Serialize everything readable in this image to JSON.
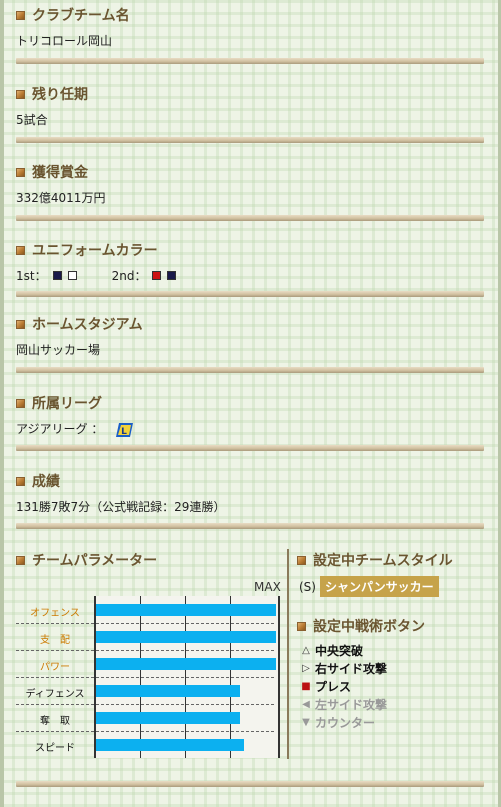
{
  "sections": {
    "club": {
      "title": "クラブチーム名",
      "value": "トリコロール岡山"
    },
    "term": {
      "title": "残り任期",
      "value": "5試合"
    },
    "prize": {
      "title": "獲得賞金",
      "value": "332億4011万円"
    },
    "uniform": {
      "title": "ユニフォームカラー",
      "first_label": "1st：",
      "second_label": "2nd：",
      "first_colors": [
        "#1a1a4a",
        "#ffffff"
      ],
      "second_colors": [
        "#cc1111",
        "#1a1a4a"
      ]
    },
    "stadium": {
      "title": "ホームスタジアム",
      "value": "岡山サッカー場"
    },
    "league": {
      "title": "所属リーグ",
      "value": "アジアリーグ ：",
      "logo_icon": "league-logo-icon"
    },
    "record": {
      "title": "成績",
      "value": "131勝7敗7分（公式戦記録：29連勝）"
    }
  },
  "parameters": {
    "title": "チームパラメーター",
    "max_label": "MAX",
    "rows": [
      {
        "label": "オフェンス",
        "value": 1.0,
        "color": "#cc7a00"
      },
      {
        "label": "支　配",
        "value": 1.0,
        "color": "#cc7a00"
      },
      {
        "label": "パワー",
        "value": 1.0,
        "color": "#cc7a00"
      },
      {
        "label": "ディフェンス",
        "value": 0.8,
        "color": "#111111"
      },
      {
        "label": "奪　取",
        "value": 0.8,
        "color": "#111111"
      },
      {
        "label": "スピード",
        "value": 0.82,
        "color": "#111111"
      }
    ]
  },
  "team_style": {
    "title": "設定中チームスタイル",
    "prefix": "(S)",
    "value": "シャンパンサッカー"
  },
  "tactics": {
    "title": "設定中戦術ボタン",
    "items": [
      {
        "label": "中央突破",
        "icon": "triangle-up-outline-icon",
        "active": true
      },
      {
        "label": "右サイド攻撃",
        "icon": "triangle-right-outline-icon",
        "active": true
      },
      {
        "label": "プレス",
        "icon": "red-square-icon",
        "active": true
      },
      {
        "label": "左サイド攻撃",
        "icon": "triangle-left-icon",
        "active": false
      },
      {
        "label": "カウンター",
        "icon": "triangle-down-icon",
        "active": false
      }
    ]
  },
  "colors": {
    "bar": "#0cb0f0",
    "badge": "#c6a34a",
    "title": "#6a5530"
  }
}
